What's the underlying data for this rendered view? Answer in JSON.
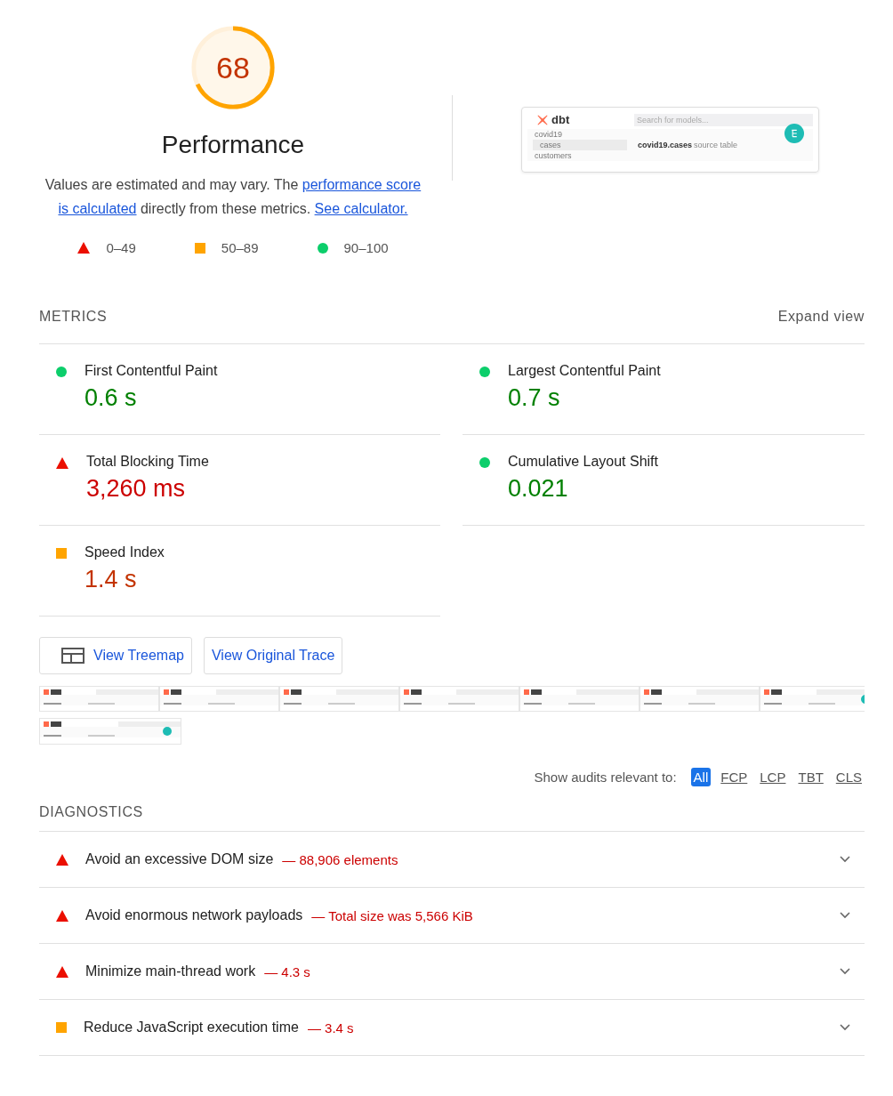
{
  "gauge": {
    "score": "68",
    "level": 0.68,
    "title": "Performance"
  },
  "description": [
    {
      "kind": "text",
      "text": "Values are estimated and may vary. The "
    },
    {
      "kind": "link",
      "text": "performance score"
    },
    {
      "kind": "link",
      "text": "is calculated"
    },
    {
      "kind": "text",
      "text": " directly from these metrics. "
    },
    {
      "kind": "link",
      "text": "See calculator."
    }
  ],
  "legend": [
    {
      "kind": "fail",
      "label": "0–49"
    },
    {
      "kind": "average",
      "label": "50–89"
    },
    {
      "kind": "pass",
      "label": "90–100"
    }
  ],
  "screenshot": {
    "logo": "dbt",
    "search_placeholder": "Search for models...",
    "tree": [
      {
        "kind": "folder",
        "label": "covid19",
        "selected": false
      },
      {
        "kind": "file",
        "label": "cases",
        "selected": true
      },
      {
        "kind": "folder-empty",
        "label": "customers",
        "selected": false
      }
    ],
    "title": "covid19.cases",
    "subtitle": "source table"
  },
  "metrics": {
    "heading": "METRICS",
    "toggle": "Expand view",
    "items": [
      {
        "kind": "pass",
        "name": "First Contentful Paint",
        "value": "0.6 s"
      },
      {
        "kind": "pass",
        "name": "Largest Contentful Paint",
        "value": "0.7 s"
      },
      {
        "kind": "fail",
        "name": "Total Blocking Time",
        "value": "3,260 ms"
      },
      {
        "kind": "pass",
        "name": "Cumulative Layout Shift",
        "value": "0.021"
      },
      {
        "kind": "average",
        "name": "Speed Index",
        "value": "1.4 s"
      }
    ]
  },
  "buttons": [
    {
      "kind": "treemap",
      "label": "View Treemap"
    },
    {
      "kind": "trace",
      "label": "View Original Trace"
    }
  ],
  "filmstrip": [
    {
      "kind": "loading"
    },
    {
      "kind": "loading"
    },
    {
      "kind": "loading"
    },
    {
      "kind": "loading"
    },
    {
      "kind": "loading"
    },
    {
      "kind": "loading"
    },
    {
      "kind": "loaded"
    },
    {
      "kind": "final"
    }
  ],
  "filter": {
    "label": "Show audits relevant to:",
    "chips": [
      {
        "label": "All",
        "selected": true
      },
      {
        "label": "FCP",
        "selected": false
      },
      {
        "label": "LCP",
        "selected": false
      },
      {
        "label": "TBT",
        "selected": false
      },
      {
        "label": "CLS",
        "selected": false
      }
    ]
  },
  "diagnostics": {
    "heading": "DIAGNOSTICS",
    "items": [
      {
        "kind": "fail",
        "title": "Avoid an excessive DOM size",
        "detail": "— 88,906 elements",
        "expanded": false
      },
      {
        "kind": "fail",
        "title": "Avoid enormous network payloads",
        "detail": "— Total size was 5,566 KiB",
        "expanded": false
      },
      {
        "kind": "fail",
        "title": "Minimize main-thread work",
        "detail": "— 4.3 s",
        "expanded": false
      },
      {
        "kind": "average",
        "title": "Reduce JavaScript execution time",
        "detail": "— 3.4 s",
        "expanded": false
      }
    ]
  }
}
